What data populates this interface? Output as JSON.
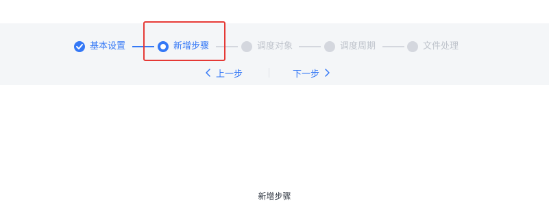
{
  "steps": [
    {
      "label": "基本设置",
      "status": "done"
    },
    {
      "label": "新增步骤",
      "status": "current"
    },
    {
      "label": "调度对象",
      "status": "pending"
    },
    {
      "label": "调度周期",
      "status": "pending"
    },
    {
      "label": "文件处理",
      "status": "pending"
    }
  ],
  "nav": {
    "prev_label": "上一步",
    "next_label": "下一步"
  },
  "content": {
    "title": "新增步骤"
  },
  "colors": {
    "primary": "#3478f6",
    "pending": "#d4d7de",
    "band_background": "#f4f6f8",
    "highlight": "#e53935"
  },
  "icons": {
    "done": "check-circle-icon",
    "current": "current-step-icon",
    "pending": "pending-step-icon",
    "prev": "chevron-left-icon",
    "next": "chevron-right-icon"
  }
}
